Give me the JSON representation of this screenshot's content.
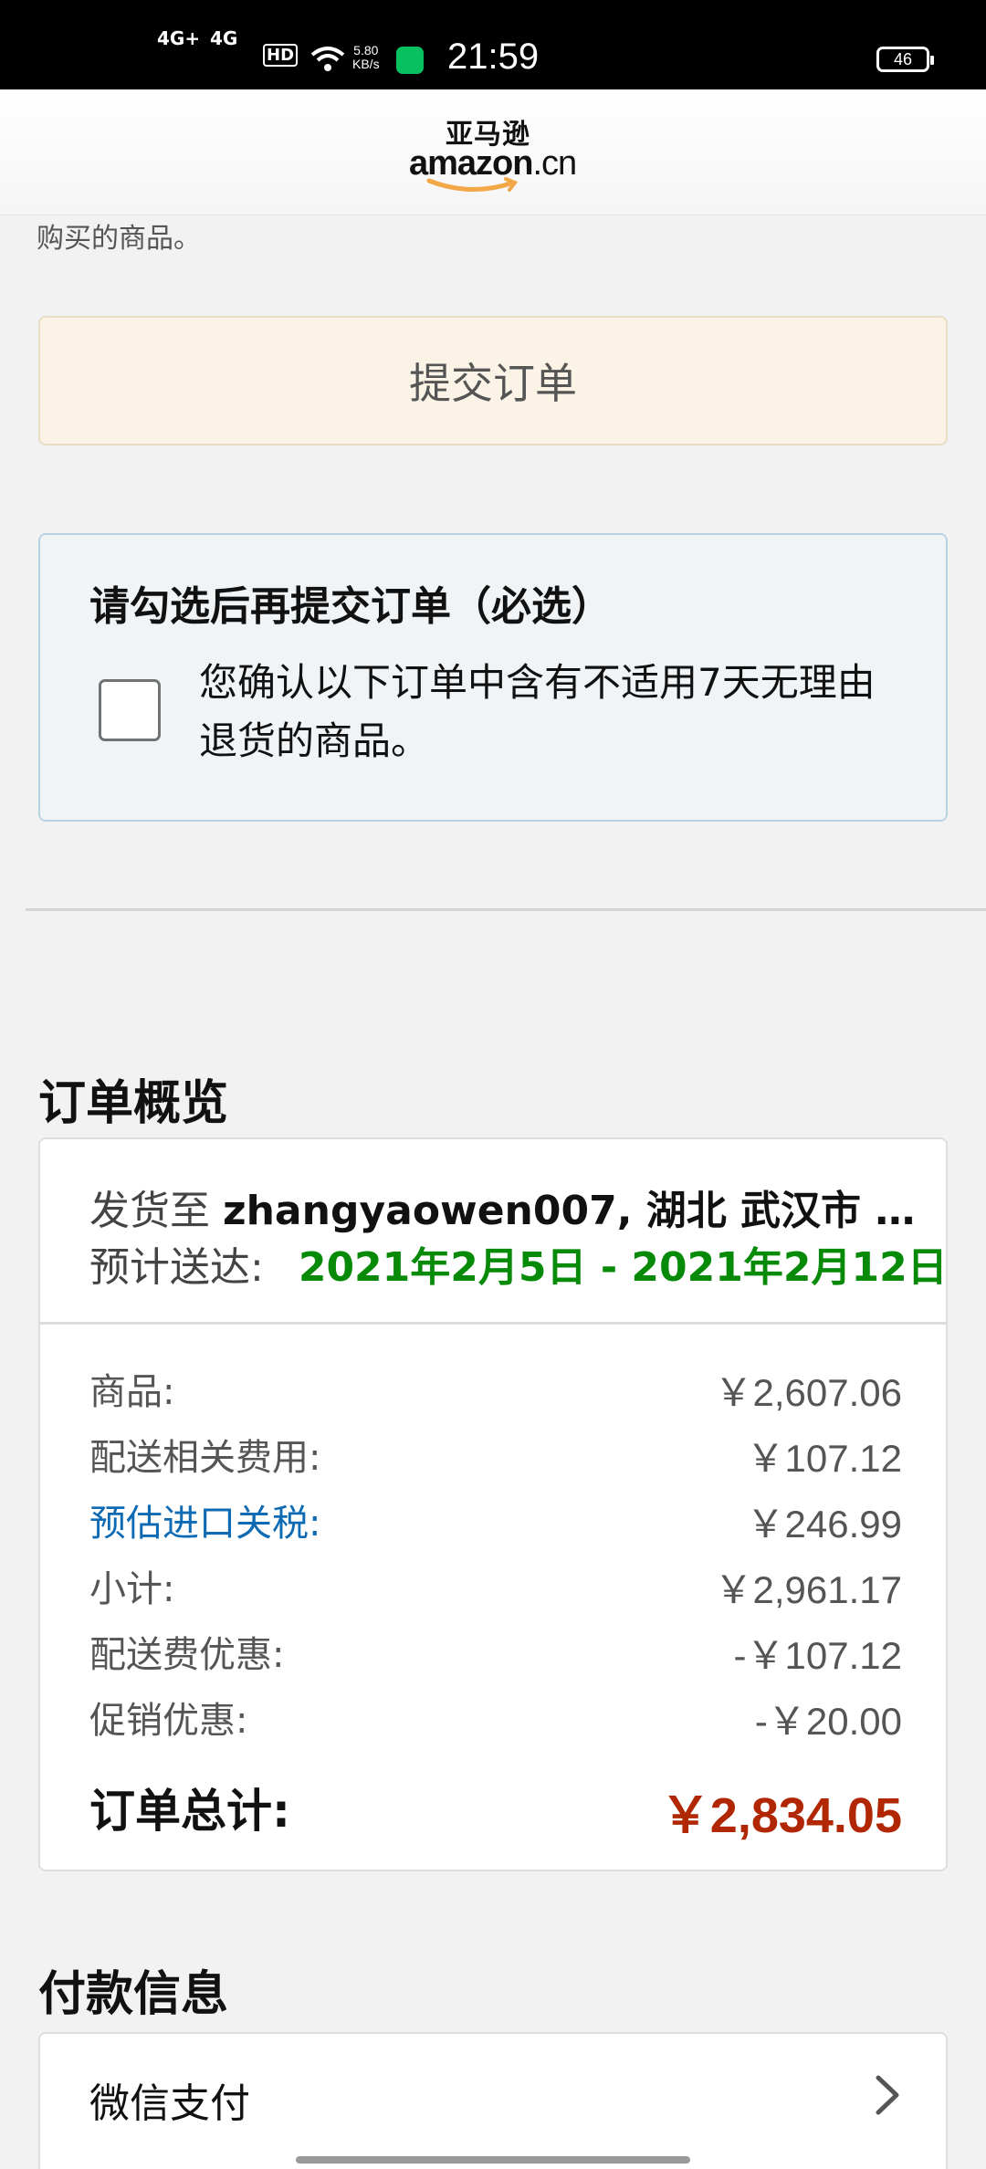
{
  "status_bar": {
    "signal_1": "4G+",
    "signal_2": "4G",
    "hd": "HD",
    "speed_value": "5.80",
    "speed_unit": "KB/s",
    "time": "21:59",
    "battery": "46"
  },
  "header": {
    "logo_cn": "亚马逊",
    "logo_en": "amazon",
    "logo_suffix": ".cn"
  },
  "top_text": "购买的商品。",
  "submit_button": "提交订单",
  "confirm": {
    "title": "请勾选后再提交订单（必选）",
    "text": "您确认以下订单中含有不适用7天无理由退货的商品。",
    "checked": false
  },
  "order_overview": {
    "title": "订单概览",
    "ship_to_label": "发货至",
    "ship_to_value": "zhangyaowen007, 湖北 武汉市 …",
    "eta_label": "预计送达:",
    "eta_value": "2021年2月5日 - 2021年2月12日",
    "lines": [
      {
        "label": "商品:",
        "value": "￥2,607.06"
      },
      {
        "label": "配送相关费用:",
        "value": "￥107.12"
      },
      {
        "label": "预估进口关税:",
        "value": "￥246.99"
      },
      {
        "label": "小计:",
        "value": "￥2,961.17"
      },
      {
        "label": "配送费优惠:",
        "value": "-￥107.12"
      },
      {
        "label": "促销优惠:",
        "value": "-￥20.00"
      }
    ],
    "total_label": "订单总计:",
    "total_value": "￥2,834.05"
  },
  "payment": {
    "title": "付款信息",
    "method": "微信支付"
  },
  "colors": {
    "accent_green": "#078a07",
    "total_red": "#b12704",
    "link_blue": "#0e6bb3",
    "submit_bg": "#faf3e6"
  }
}
